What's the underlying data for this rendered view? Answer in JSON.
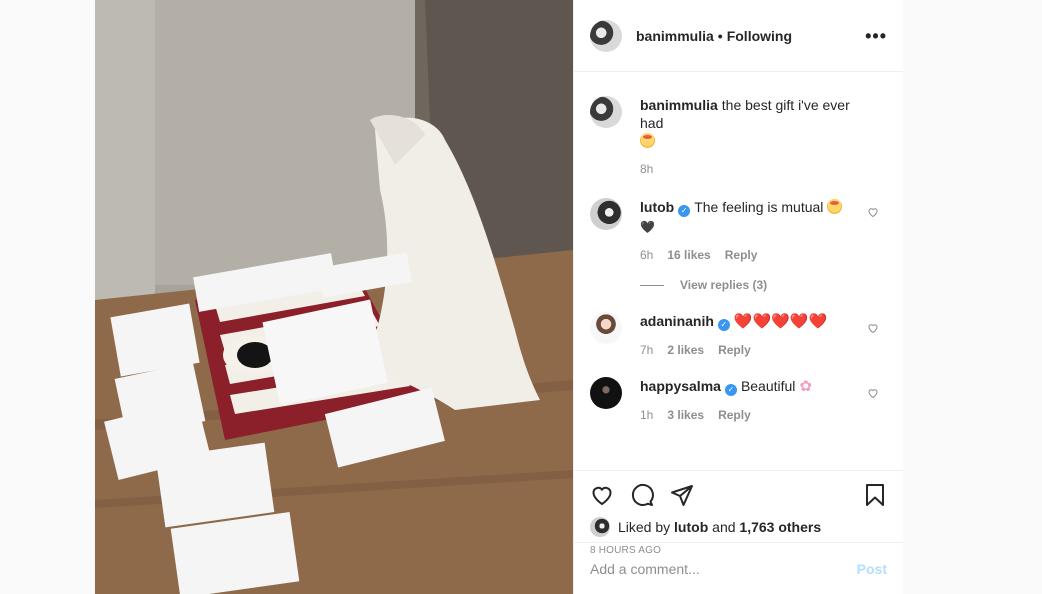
{
  "post": {
    "author": "banimmulia",
    "separator": "•",
    "follow_status": "Following",
    "more_icon": "more-horizontal-icon"
  },
  "caption": {
    "author": "banimmulia",
    "text": "the best gift i've ever had",
    "emoji": "smiling-face-with-hearts",
    "time": "8h"
  },
  "comments": [
    {
      "author": "lutob",
      "verified": true,
      "text": "The feeling is mutual",
      "emoji": "smiling-face-with-hearts",
      "extra": "🖤",
      "time": "6h",
      "likes": "16 likes",
      "reply": "Reply",
      "view_replies": "View replies (3)"
    },
    {
      "author": "adaninanih",
      "verified": true,
      "text": "❤️❤️❤️❤️❤️",
      "time": "7h",
      "likes": "2 likes",
      "reply": "Reply"
    },
    {
      "author": "happysalma",
      "verified": true,
      "text": "Beautiful",
      "emoji": "cherry-blossom",
      "time": "1h",
      "likes": "3 likes",
      "reply": "Reply"
    }
  ],
  "actions": {
    "liked_by_prefix": "Liked by",
    "liked_by_user": "lutob",
    "and": "and",
    "others": "1,763 others",
    "timestamp": "8 HOURS AGO"
  },
  "comment_box": {
    "placeholder": "Add a comment...",
    "post_label": "Post"
  },
  "colors": {
    "accent": "#3897f0",
    "post_disabled": "#b2dffc",
    "muted": "#8e8e8e"
  }
}
